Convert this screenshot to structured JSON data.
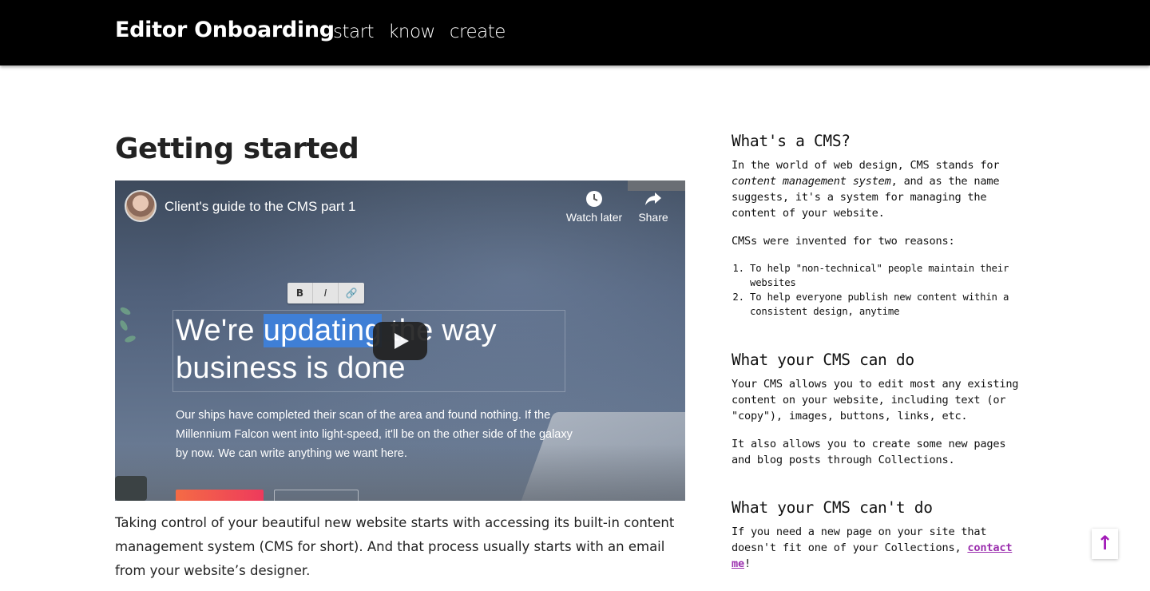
{
  "header": {
    "brand": "Editor Onboarding",
    "nav": [
      "start",
      "know",
      "create"
    ]
  },
  "main": {
    "title": "Getting started",
    "video": {
      "title": "Client's guide to the CMS part 1",
      "watch_later": "Watch later",
      "share": "Share",
      "toolbar": [
        "B",
        "I",
        "🔗"
      ],
      "headline_pre": "We're ",
      "headline_hl": "updating",
      "headline_post": " the way",
      "headline_line2": "business is done",
      "body": "Our ships have completed their scan of the area and found nothing. If the Millennium Falcon went into light-speed, it'll be on the other side of the galaxy by now. We can write anything we want here."
    },
    "lead": "Taking control of your beautiful new website starts with accessing its built-in content management system (CMS for short). And that process usually starts with an email from your website’s designer."
  },
  "sidebar": {
    "s1_title": "What's a CMS?",
    "s1_p1_a": "In the world of web design, CMS stands for ",
    "s1_p1_em": "content management system",
    "s1_p1_b": ", and as the name suggests, it's a system for managing the content of your website.",
    "s1_p2": "CMSs were invented for two reasons:",
    "s1_list": [
      "To help \"non-technical\" people maintain their websites",
      "To help everyone publish new content within a consistent design, anytime"
    ],
    "s2_title": "What your CMS can do",
    "s2_p1": "Your CMS allows you to edit most any existing content on your website, including text (or \"copy\"), images, buttons, links, etc.",
    "s2_p2": "It also allows you to create some new pages and blog posts through Collections.",
    "s3_title": "What your CMS can't do",
    "s3_p1": "If you need a new page on your site that doesn't fit one of your Collections, ",
    "s3_link": "contact me",
    "s3_end": "!"
  },
  "to_top": "↑",
  "colors": {
    "header_bg": "#000000",
    "link": "#9b2fae",
    "highlight": "#3f7fd6"
  }
}
